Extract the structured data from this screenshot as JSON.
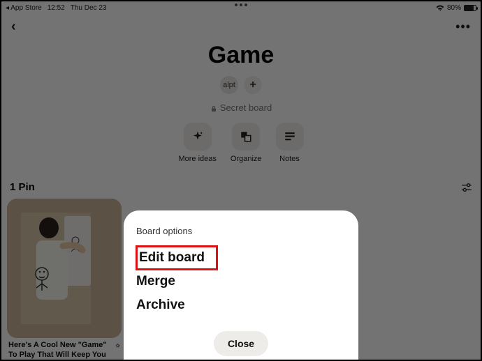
{
  "statusbar": {
    "back_app": "App Store",
    "time": "12:52",
    "date": "Thu Dec 23",
    "battery_pct": "80%"
  },
  "nav": {},
  "board": {
    "title": "Game",
    "collaborator": "alpt",
    "secret_label": "Secret board"
  },
  "actions": {
    "more_ideas": "More ideas",
    "organize": "Organize",
    "notes": "Notes"
  },
  "section": {
    "pin_count": "1 Pin"
  },
  "pin": {
    "caption": "Here's A Cool New \"Game\" To Play That Will Keep You"
  },
  "sheet": {
    "title": "Board options",
    "edit": "Edit board",
    "merge": "Merge",
    "archive": "Archive",
    "close": "Close"
  }
}
